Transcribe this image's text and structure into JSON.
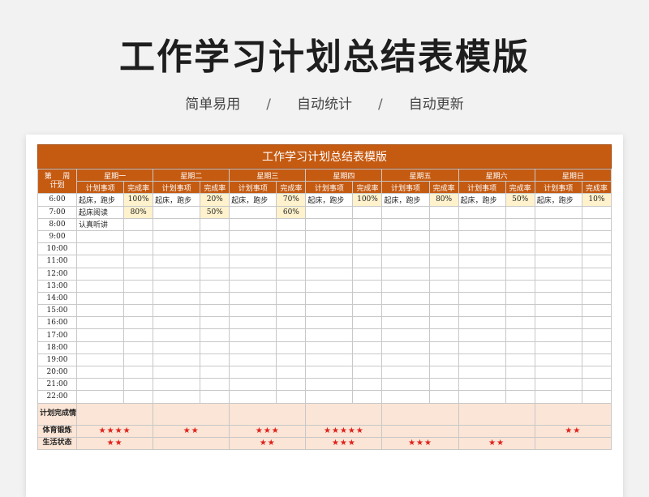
{
  "page": {
    "title": "工作学习计划总结表模版",
    "tags": [
      "简单易用",
      "自动统计",
      "自动更新"
    ],
    "separator": "/"
  },
  "sheet": {
    "title": "工作学习计划总结表模版",
    "corner_line1": "第___周",
    "corner_line2": "计划",
    "days": [
      "星期一",
      "星期二",
      "星期三",
      "星期四",
      "星期五",
      "星期六",
      "星期日"
    ],
    "col_item": "计划事项",
    "col_rate": "完成率",
    "times": [
      "6:00",
      "7:00",
      "8:00",
      "9:00",
      "10:00",
      "11:00",
      "12:00",
      "13:00",
      "14:00",
      "15:00",
      "16:00",
      "17:00",
      "18:00",
      "19:00",
      "20:00",
      "21:00",
      "22:00"
    ],
    "entries": [
      [
        [
          "起床，跑步",
          "100%"
        ],
        [
          "起床，跑步",
          "20%"
        ],
        [
          "起床，跑步",
          "70%"
        ],
        [
          "起床，跑步",
          "100%"
        ],
        [
          "起床，跑步",
          "80%"
        ],
        [
          "起床，跑步",
          "50%"
        ],
        [
          "起床，跑步",
          "10%"
        ]
      ],
      [
        [
          "起床阅读",
          "80%"
        ],
        [
          "",
          "50%"
        ],
        [
          "",
          "60%"
        ],
        [
          "",
          ""
        ],
        [
          "",
          ""
        ],
        [
          "",
          ""
        ],
        [
          "",
          ""
        ]
      ],
      [
        [
          "认真听讲",
          ""
        ],
        [
          "",
          ""
        ],
        [
          "",
          ""
        ],
        [
          "",
          ""
        ],
        [
          "",
          ""
        ],
        [
          "",
          ""
        ],
        [
          "",
          ""
        ]
      ]
    ],
    "summary_label": "计划完成情况",
    "sport_label": "体育锻炼",
    "sport_stars": [
      "★★★★",
      "★★",
      "★★★",
      "★★★★★",
      "",
      "",
      "★★"
    ],
    "life_label": "生活状态",
    "life_stars": [
      "★★",
      "",
      "★★",
      "★★★",
      "★★★",
      "★★",
      ""
    ]
  }
}
